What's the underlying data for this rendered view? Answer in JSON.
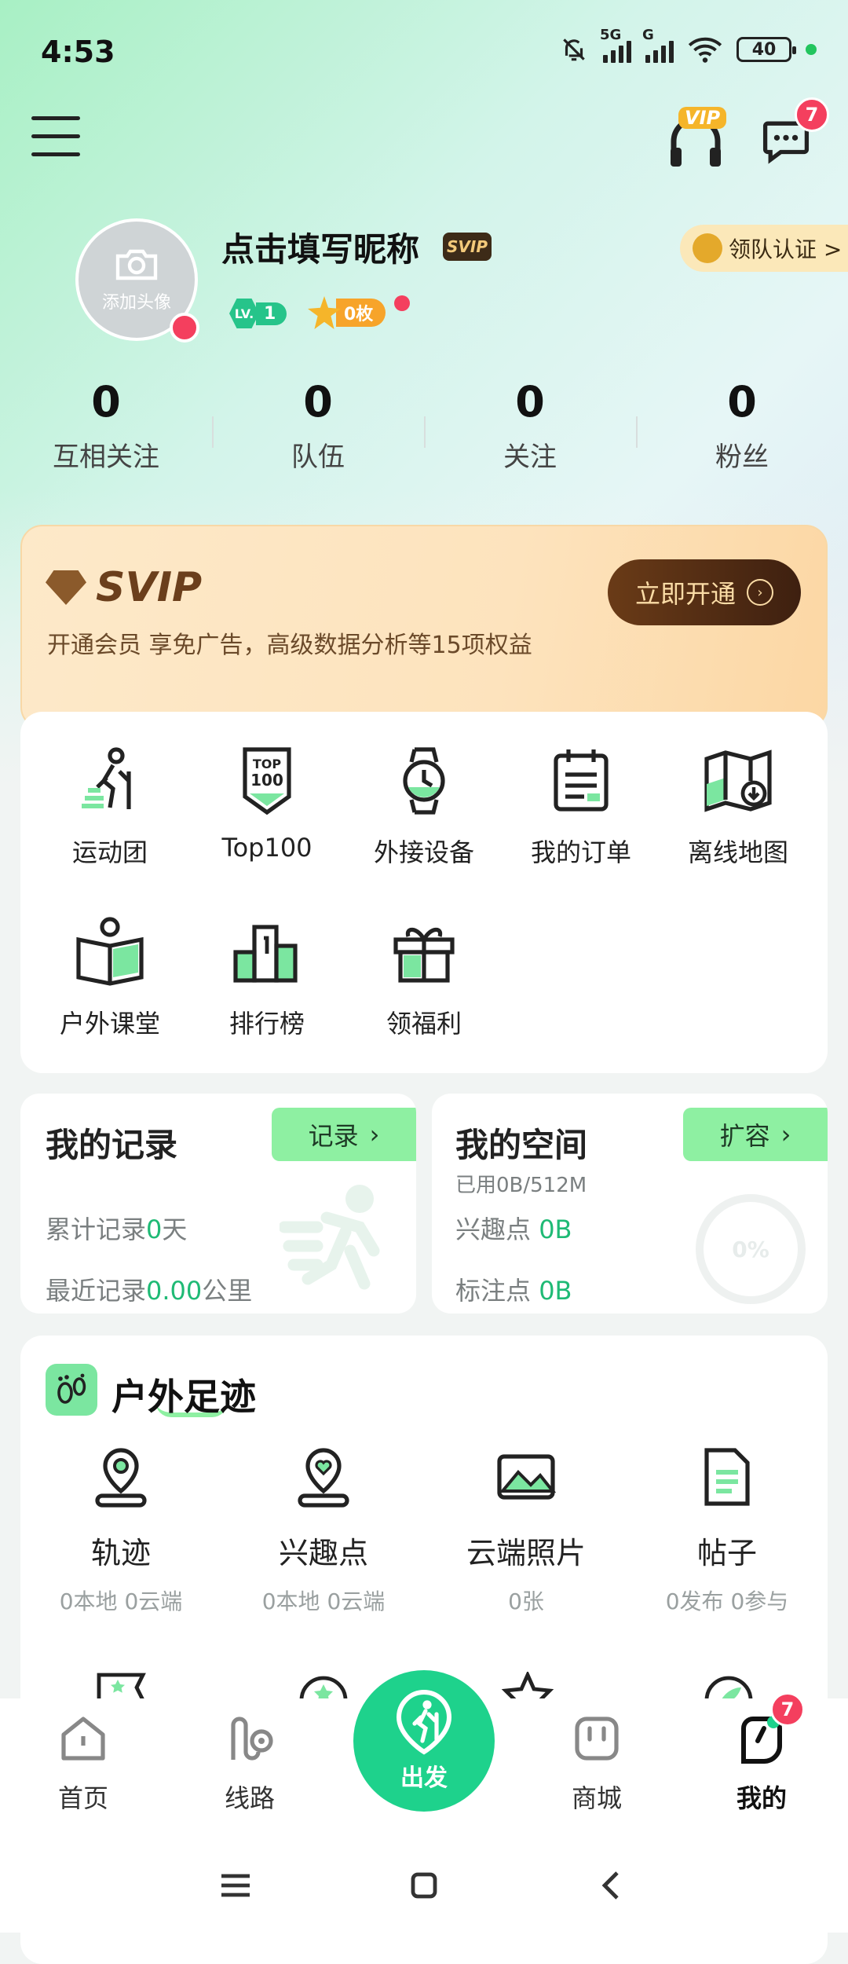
{
  "status": {
    "time": "4:53",
    "sig1": "5G",
    "sig2": "G",
    "battery": "40"
  },
  "header": {
    "vip_label": "VIP",
    "message_badge": "7"
  },
  "profile": {
    "avatar_caption": "添加头像",
    "nickname": "点击填写昵称",
    "svip_tag": "SVIP",
    "leader_cert": "领队认证 >",
    "level_label": "LV.",
    "level": "1",
    "coins": "0枚"
  },
  "stats": [
    {
      "value": "0",
      "label": "互相关注"
    },
    {
      "value": "0",
      "label": "队伍"
    },
    {
      "value": "0",
      "label": "关注"
    },
    {
      "value": "0",
      "label": "粉丝"
    }
  ],
  "svip": {
    "title": "SVIP",
    "desc": "开通会员 享免广告，高级数据分析等15项权益",
    "button": "立即开通"
  },
  "functions": [
    {
      "label": "运动团",
      "icon": "hiker-icon"
    },
    {
      "label": "Top100",
      "icon": "top100-badge-icon"
    },
    {
      "label": "外接设备",
      "icon": "watch-icon"
    },
    {
      "label": "我的订单",
      "icon": "order-list-icon"
    },
    {
      "label": "离线地图",
      "icon": "offline-map-icon"
    },
    {
      "label": "户外课堂",
      "icon": "book-icon"
    },
    {
      "label": "排行榜",
      "icon": "podium-icon"
    },
    {
      "label": "领福利",
      "icon": "gift-icon"
    }
  ],
  "records": {
    "title": "我的记录",
    "button": "记录",
    "line1_prefix": "累计记录",
    "line1_value": "0",
    "line1_suffix": "天",
    "line2_prefix": "最近记录",
    "line2_value": "0.00",
    "line2_suffix": "公里"
  },
  "space": {
    "title": "我的空间",
    "button": "扩容",
    "used": "已用0B/512M",
    "poi_label": "兴趣点",
    "poi_value": "0B",
    "mark_label": "标注点",
    "mark_value": "0B",
    "percent": "0%"
  },
  "footprint": {
    "title": "户外足迹",
    "items": [
      {
        "label": "轨迹",
        "sub": "0本地 0云端",
        "icon": "track-pin-icon"
      },
      {
        "label": "兴趣点",
        "sub": "0本地 0云端",
        "icon": "heart-pin-icon"
      },
      {
        "label": "云端照片",
        "sub": "0张",
        "icon": "photo-icon"
      },
      {
        "label": "帖子",
        "sub": "0发布 0参与",
        "icon": "document-icon"
      }
    ]
  },
  "tabbar": {
    "home": "首页",
    "routes": "线路",
    "go": "出发",
    "mall": "商城",
    "mine": "我的",
    "mine_badge": "7"
  },
  "colors": {
    "accent": "#1ed28c",
    "badge": "#f43f5e",
    "svip_brown": "#6b3f1c"
  }
}
